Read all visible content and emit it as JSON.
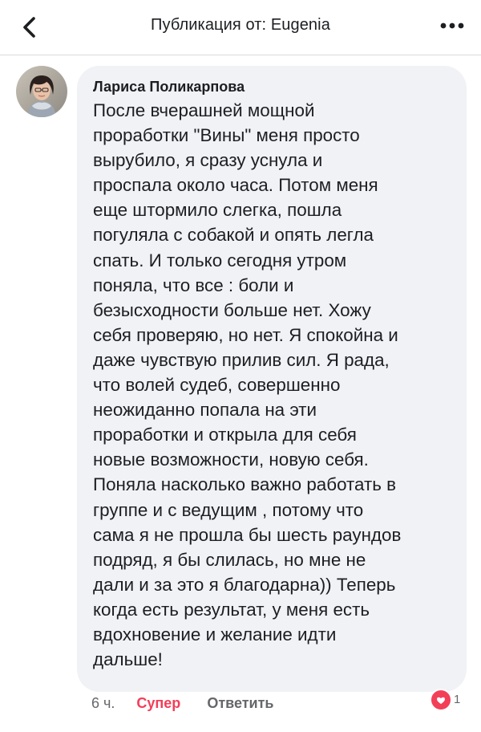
{
  "header": {
    "title": "Публикация от: Eugenia",
    "back_icon": "chevron-left-icon",
    "more_icon": "more-dots-icon"
  },
  "comment": {
    "author": "Лариса Поликарпова",
    "lines": [
      "После вчерашней мощной",
      "проработки \"Вины\" меня просто",
      "вырубило, я сразу уснула и",
      "проспала около часа. Потом меня",
      "еще штормило слегка, пошла",
      "погуляла с собакой и опять легла",
      "спать. И только сегодня утром",
      "поняла, что все : боли и",
      "безысходности больше нет. Хожу",
      "себя проверяю, но нет. Я спокойна и",
      "даже чувствую прилив сил. Я рада,",
      "что волей судеб, совершенно",
      "неожиданно попала на эти",
      "проработки и открыла для себя",
      "новые возможности, новую себя.",
      "Поняла насколько важно работать в",
      "группе и с ведущим , потому что",
      "сама я не прошла бы шесть раундов",
      "подряд, я бы слилась, но мне не",
      "дали и за это я благодарна)) Теперь",
      "когда есть результат, у меня есть",
      "вдохновение и желание идти",
      "дальше!"
    ],
    "time": "6 ч.",
    "reaction_label": "Супер",
    "reply_label": "Ответить",
    "reaction_icon": "care-reaction-icon",
    "reaction_count": "1"
  },
  "colors": {
    "accent": "#f33e58",
    "bubble": "#f0f2f5",
    "text": "#1c1e21",
    "muted": "#65676b"
  }
}
